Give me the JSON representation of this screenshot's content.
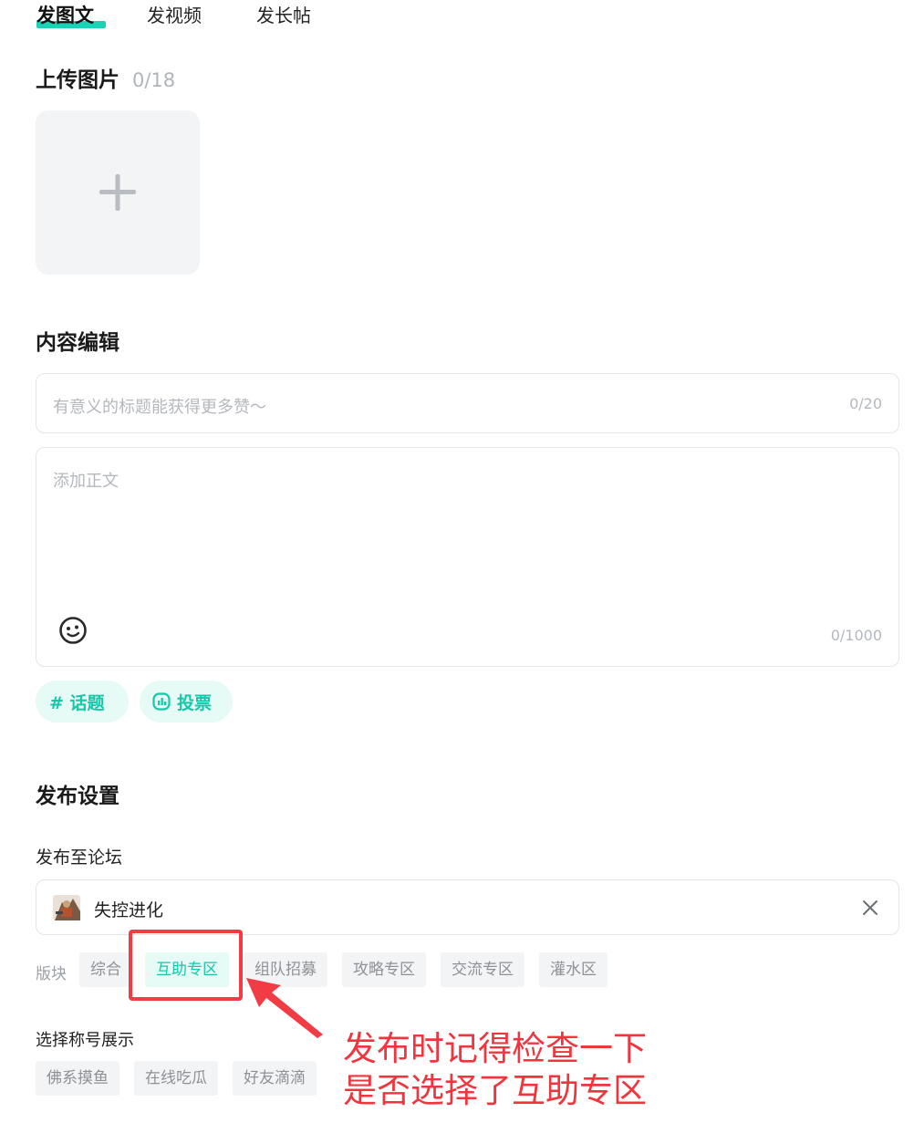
{
  "tabs": [
    {
      "label": "发图文",
      "active": true
    },
    {
      "label": "发视频",
      "active": false
    },
    {
      "label": "发长帖",
      "active": false
    }
  ],
  "upload": {
    "title": "上传图片",
    "count": "0/18",
    "add_icon": "plus-icon"
  },
  "content": {
    "title": "内容编辑",
    "title_placeholder": "有意义的标题能获得更多赞～",
    "title_count": "0/20",
    "body_placeholder": "添加正文",
    "body_count": "0/1000",
    "emoji_icon": "emoji-icon",
    "topic_label": "# 话题",
    "vote_label": "投票",
    "vote_icon": "vote-icon"
  },
  "publish": {
    "title": "发布设置",
    "forum_label": "发布至论坛",
    "forum_name": "失控进化",
    "forum_avatar": "game-avatar",
    "clear_icon": "close-icon",
    "section_label": "版块",
    "sections": [
      {
        "label": "综合",
        "active": false
      },
      {
        "label": "互助专区",
        "active": true
      },
      {
        "label": "组队招募",
        "active": false
      },
      {
        "label": "攻略专区",
        "active": false
      },
      {
        "label": "交流专区",
        "active": false
      },
      {
        "label": "灌水区",
        "active": false
      }
    ],
    "badge_label": "选择称号展示",
    "badges": [
      "佛系摸鱼",
      "在线吃瓜",
      "好友滴滴"
    ]
  },
  "annotation": {
    "line1": "发布时记得检查一下",
    "line2": "是否选择了互助专区",
    "color": "#f0353e"
  },
  "colors": {
    "accent": "#17c7a9",
    "accent_bg": "#e6faf6",
    "annotation_red": "#f23c45"
  }
}
